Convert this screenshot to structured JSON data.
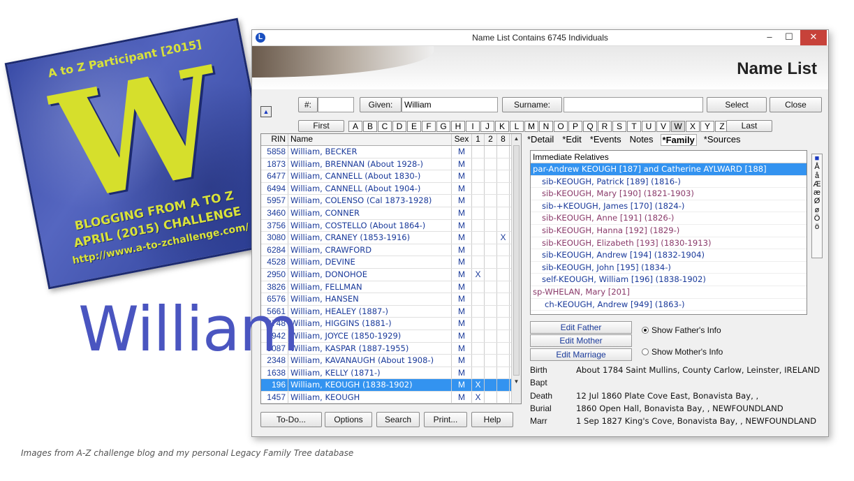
{
  "badge": {
    "top_text": "A to Z Participant [2015]",
    "letter": "W",
    "line1": "BLOGGING FROM A TO Z",
    "line2": "APRIL (2015) CHALLENGE",
    "line3": "http://www.a-to-zchallenge.com/"
  },
  "overlay_word": "William",
  "caption": "Images from A-Z challenge blog and my personal Legacy Family Tree database",
  "window": {
    "title": "Name List Contains 6745 Individuals",
    "app_icon": "L",
    "controls": {
      "min": "–",
      "max": "☐",
      "close": "✕"
    },
    "banner_title": "Name List"
  },
  "search": {
    "num_label": "#:",
    "num_value": "",
    "given_label": "Given:",
    "given_value": "William",
    "surname_label": "Surname:",
    "surname_value": "",
    "select_label": "Select",
    "close_label": "Close",
    "up_icon": "▲"
  },
  "alphabet": {
    "first": "First",
    "last": "Last",
    "letters": [
      "A",
      "B",
      "C",
      "D",
      "E",
      "F",
      "G",
      "H",
      "I",
      "J",
      "K",
      "L",
      "M",
      "N",
      "O",
      "P",
      "Q",
      "R",
      "S",
      "T",
      "U",
      "V",
      "W",
      "X",
      "Y",
      "Z"
    ],
    "selected": "W"
  },
  "grid": {
    "headers": {
      "rin": "RIN",
      "name": "Name",
      "sex": "Sex",
      "c1": "1",
      "c2": "2",
      "c8": "8"
    },
    "rows": [
      {
        "rin": "5858",
        "name": "William, BECKER",
        "sex": "M",
        "c1": "",
        "c2": "",
        "c8": ""
      },
      {
        "rin": "1873",
        "name": "William, BRENNAN (About 1928-)",
        "sex": "M",
        "c1": "",
        "c2": "",
        "c8": ""
      },
      {
        "rin": "6477",
        "name": "William, CANNELL (About 1830-)",
        "sex": "M",
        "c1": "",
        "c2": "",
        "c8": ""
      },
      {
        "rin": "6494",
        "name": "William, CANNELL (About 1904-)",
        "sex": "M",
        "c1": "",
        "c2": "",
        "c8": ""
      },
      {
        "rin": "5957",
        "name": "William, COLENSO (Cal 1873-1928)",
        "sex": "M",
        "c1": "",
        "c2": "",
        "c8": ""
      },
      {
        "rin": "3460",
        "name": "William, CONNER",
        "sex": "M",
        "c1": "",
        "c2": "",
        "c8": ""
      },
      {
        "rin": "3756",
        "name": "William, COSTELLO (About 1864-)",
        "sex": "M",
        "c1": "",
        "c2": "",
        "c8": ""
      },
      {
        "rin": "3080",
        "name": "William, CRANEY (1853-1916)",
        "sex": "M",
        "c1": "",
        "c2": "",
        "c8": "X"
      },
      {
        "rin": "6284",
        "name": "William, CRAWFORD",
        "sex": "M",
        "c1": "",
        "c2": "",
        "c8": ""
      },
      {
        "rin": "4528",
        "name": "William, DEVINE",
        "sex": "M",
        "c1": "",
        "c2": "",
        "c8": ""
      },
      {
        "rin": "2950",
        "name": "William, DONOHOE",
        "sex": "M",
        "c1": "X",
        "c2": "",
        "c8": ""
      },
      {
        "rin": "3826",
        "name": "William, FELLMAN",
        "sex": "M",
        "c1": "",
        "c2": "",
        "c8": ""
      },
      {
        "rin": "6576",
        "name": "William, HANSEN",
        "sex": "M",
        "c1": "",
        "c2": "",
        "c8": ""
      },
      {
        "rin": "5661",
        "name": "William, HEALEY (1887-)",
        "sex": "M",
        "c1": "",
        "c2": "",
        "c8": ""
      },
      {
        "rin": "3748",
        "name": "William, HIGGINS (1881-)",
        "sex": "M",
        "c1": "",
        "c2": "",
        "c8": ""
      },
      {
        "rin": "2942",
        "name": "William, JOYCE (1850-1929)",
        "sex": "M",
        "c1": "",
        "c2": "",
        "c8": ""
      },
      {
        "rin": "5087",
        "name": "William, KASPAR (1887-1955)",
        "sex": "M",
        "c1": "",
        "c2": "",
        "c8": ""
      },
      {
        "rin": "2348",
        "name": "William, KAVANAUGH (About 1908-)",
        "sex": "M",
        "c1": "",
        "c2": "",
        "c8": ""
      },
      {
        "rin": "1638",
        "name": "William, KELLY (1871-)",
        "sex": "M",
        "c1": "",
        "c2": "",
        "c8": ""
      },
      {
        "rin": "196",
        "name": "William, KEOUGH (1838-1902)",
        "sex": "M",
        "c1": "X",
        "c2": "",
        "c8": ""
      },
      {
        "rin": "1457",
        "name": "William, KEOUGH",
        "sex": "M",
        "c1": "X",
        "c2": "",
        "c8": ""
      }
    ],
    "selected_rin": "196"
  },
  "tabs": [
    "*Detail",
    "*Edit",
    "*Events",
    "Notes",
    "*Family",
    "*Sources"
  ],
  "active_tab": "*Family",
  "relatives": {
    "header": "Immediate Relatives",
    "rows": [
      {
        "text": "par-Andrew KEOUGH [187] and Catherine AYLWARD [188]",
        "gender": "male",
        "level": 0,
        "selected": true
      },
      {
        "text": "sib-KEOUGH, Patrick [189] (1816-)",
        "gender": "male",
        "level": 1,
        "selected": false
      },
      {
        "text": "sib-KEOUGH, Mary [190] (1821-1903)",
        "gender": "female",
        "level": 1,
        "selected": false
      },
      {
        "text": "sib-+KEOUGH, James [170] (1824-)",
        "gender": "male",
        "level": 1,
        "selected": false
      },
      {
        "text": "sib-KEOUGH, Anne [191] (1826-)",
        "gender": "female",
        "level": 1,
        "selected": false
      },
      {
        "text": "sib-KEOUGH, Hanna [192] (1829-)",
        "gender": "female",
        "level": 1,
        "selected": false
      },
      {
        "text": "sib-KEOUGH, Elizabeth [193] (1830-1913)",
        "gender": "female",
        "level": 1,
        "selected": false
      },
      {
        "text": "sib-KEOUGH, Andrew [194] (1832-1904)",
        "gender": "male",
        "level": 1,
        "selected": false
      },
      {
        "text": "sib-KEOUGH, John [195] (1834-)",
        "gender": "male",
        "level": 1,
        "selected": false
      },
      {
        "text": "self-KEOUGH, William [196] (1838-1902)",
        "gender": "male",
        "level": 1,
        "selected": false
      },
      {
        "text": "sp-WHELAN, Mary [201]",
        "gender": "female",
        "level": 0,
        "selected": false
      },
      {
        "text": "ch-KEOUGH, Andrew [949] (1863-)",
        "gender": "male",
        "level": 2,
        "selected": false
      }
    ]
  },
  "special_chars": [
    "■",
    "Å",
    "å",
    "Æ",
    "æ",
    "Ø",
    "ø",
    "Ö",
    "ö"
  ],
  "edit_buttons": {
    "father": "Edit Father",
    "mother": "Edit Mother",
    "marriage": "Edit Marriage"
  },
  "radios": {
    "father": "Show Father's Info",
    "mother": "Show Mother's Info",
    "selected": "father"
  },
  "events": [
    {
      "label": "Birth",
      "value": "About 1784 Saint Mullins, County Carlow, Leinster, IRELAND"
    },
    {
      "label": "Bapt",
      "value": ""
    },
    {
      "label": "Death",
      "value": "12 Jul 1860 Plate Cove East, Bonavista Bay, ,"
    },
    {
      "label": "Burial",
      "value": "1860 Open Hall, Bonavista Bay, , NEWFOUNDLAND"
    },
    {
      "label": "Marr",
      "value": "1 Sep 1827 King's Cove, Bonavista Bay, , NEWFOUNDLAND"
    }
  ],
  "bottom_buttons": {
    "todo": "To-Do...",
    "options": "Options",
    "search": "Search",
    "print": "Print...",
    "help": "Help"
  }
}
